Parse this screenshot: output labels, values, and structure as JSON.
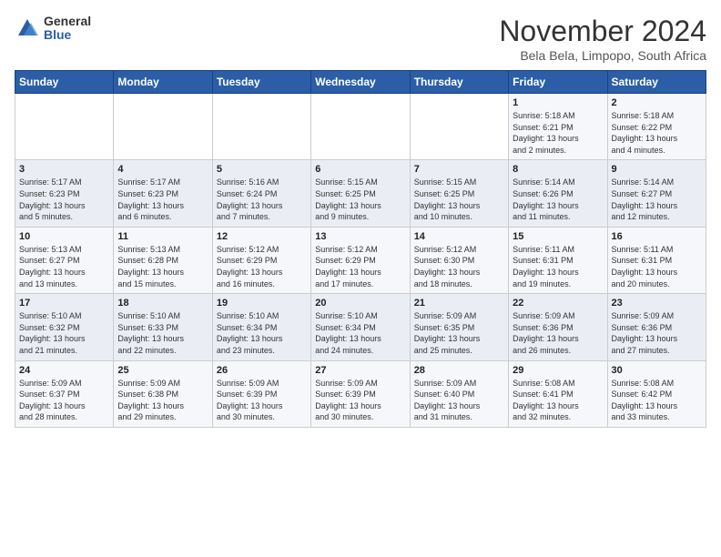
{
  "logo": {
    "general": "General",
    "blue": "Blue"
  },
  "header": {
    "month": "November 2024",
    "location": "Bela Bela, Limpopo, South Africa"
  },
  "weekdays": [
    "Sunday",
    "Monday",
    "Tuesday",
    "Wednesday",
    "Thursday",
    "Friday",
    "Saturday"
  ],
  "weeks": [
    [
      {
        "day": "",
        "info": ""
      },
      {
        "day": "",
        "info": ""
      },
      {
        "day": "",
        "info": ""
      },
      {
        "day": "",
        "info": ""
      },
      {
        "day": "",
        "info": ""
      },
      {
        "day": "1",
        "info": "Sunrise: 5:18 AM\nSunset: 6:21 PM\nDaylight: 13 hours\nand 2 minutes."
      },
      {
        "day": "2",
        "info": "Sunrise: 5:18 AM\nSunset: 6:22 PM\nDaylight: 13 hours\nand 4 minutes."
      }
    ],
    [
      {
        "day": "3",
        "info": "Sunrise: 5:17 AM\nSunset: 6:23 PM\nDaylight: 13 hours\nand 5 minutes."
      },
      {
        "day": "4",
        "info": "Sunrise: 5:17 AM\nSunset: 6:23 PM\nDaylight: 13 hours\nand 6 minutes."
      },
      {
        "day": "5",
        "info": "Sunrise: 5:16 AM\nSunset: 6:24 PM\nDaylight: 13 hours\nand 7 minutes."
      },
      {
        "day": "6",
        "info": "Sunrise: 5:15 AM\nSunset: 6:25 PM\nDaylight: 13 hours\nand 9 minutes."
      },
      {
        "day": "7",
        "info": "Sunrise: 5:15 AM\nSunset: 6:25 PM\nDaylight: 13 hours\nand 10 minutes."
      },
      {
        "day": "8",
        "info": "Sunrise: 5:14 AM\nSunset: 6:26 PM\nDaylight: 13 hours\nand 11 minutes."
      },
      {
        "day": "9",
        "info": "Sunrise: 5:14 AM\nSunset: 6:27 PM\nDaylight: 13 hours\nand 12 minutes."
      }
    ],
    [
      {
        "day": "10",
        "info": "Sunrise: 5:13 AM\nSunset: 6:27 PM\nDaylight: 13 hours\nand 13 minutes."
      },
      {
        "day": "11",
        "info": "Sunrise: 5:13 AM\nSunset: 6:28 PM\nDaylight: 13 hours\nand 15 minutes."
      },
      {
        "day": "12",
        "info": "Sunrise: 5:12 AM\nSunset: 6:29 PM\nDaylight: 13 hours\nand 16 minutes."
      },
      {
        "day": "13",
        "info": "Sunrise: 5:12 AM\nSunset: 6:29 PM\nDaylight: 13 hours\nand 17 minutes."
      },
      {
        "day": "14",
        "info": "Sunrise: 5:12 AM\nSunset: 6:30 PM\nDaylight: 13 hours\nand 18 minutes."
      },
      {
        "day": "15",
        "info": "Sunrise: 5:11 AM\nSunset: 6:31 PM\nDaylight: 13 hours\nand 19 minutes."
      },
      {
        "day": "16",
        "info": "Sunrise: 5:11 AM\nSunset: 6:31 PM\nDaylight: 13 hours\nand 20 minutes."
      }
    ],
    [
      {
        "day": "17",
        "info": "Sunrise: 5:10 AM\nSunset: 6:32 PM\nDaylight: 13 hours\nand 21 minutes."
      },
      {
        "day": "18",
        "info": "Sunrise: 5:10 AM\nSunset: 6:33 PM\nDaylight: 13 hours\nand 22 minutes."
      },
      {
        "day": "19",
        "info": "Sunrise: 5:10 AM\nSunset: 6:34 PM\nDaylight: 13 hours\nand 23 minutes."
      },
      {
        "day": "20",
        "info": "Sunrise: 5:10 AM\nSunset: 6:34 PM\nDaylight: 13 hours\nand 24 minutes."
      },
      {
        "day": "21",
        "info": "Sunrise: 5:09 AM\nSunset: 6:35 PM\nDaylight: 13 hours\nand 25 minutes."
      },
      {
        "day": "22",
        "info": "Sunrise: 5:09 AM\nSunset: 6:36 PM\nDaylight: 13 hours\nand 26 minutes."
      },
      {
        "day": "23",
        "info": "Sunrise: 5:09 AM\nSunset: 6:36 PM\nDaylight: 13 hours\nand 27 minutes."
      }
    ],
    [
      {
        "day": "24",
        "info": "Sunrise: 5:09 AM\nSunset: 6:37 PM\nDaylight: 13 hours\nand 28 minutes."
      },
      {
        "day": "25",
        "info": "Sunrise: 5:09 AM\nSunset: 6:38 PM\nDaylight: 13 hours\nand 29 minutes."
      },
      {
        "day": "26",
        "info": "Sunrise: 5:09 AM\nSunset: 6:39 PM\nDaylight: 13 hours\nand 30 minutes."
      },
      {
        "day": "27",
        "info": "Sunrise: 5:09 AM\nSunset: 6:39 PM\nDaylight: 13 hours\nand 30 minutes."
      },
      {
        "day": "28",
        "info": "Sunrise: 5:09 AM\nSunset: 6:40 PM\nDaylight: 13 hours\nand 31 minutes."
      },
      {
        "day": "29",
        "info": "Sunrise: 5:08 AM\nSunset: 6:41 PM\nDaylight: 13 hours\nand 32 minutes."
      },
      {
        "day": "30",
        "info": "Sunrise: 5:08 AM\nSunset: 6:42 PM\nDaylight: 13 hours\nand 33 minutes."
      }
    ]
  ]
}
